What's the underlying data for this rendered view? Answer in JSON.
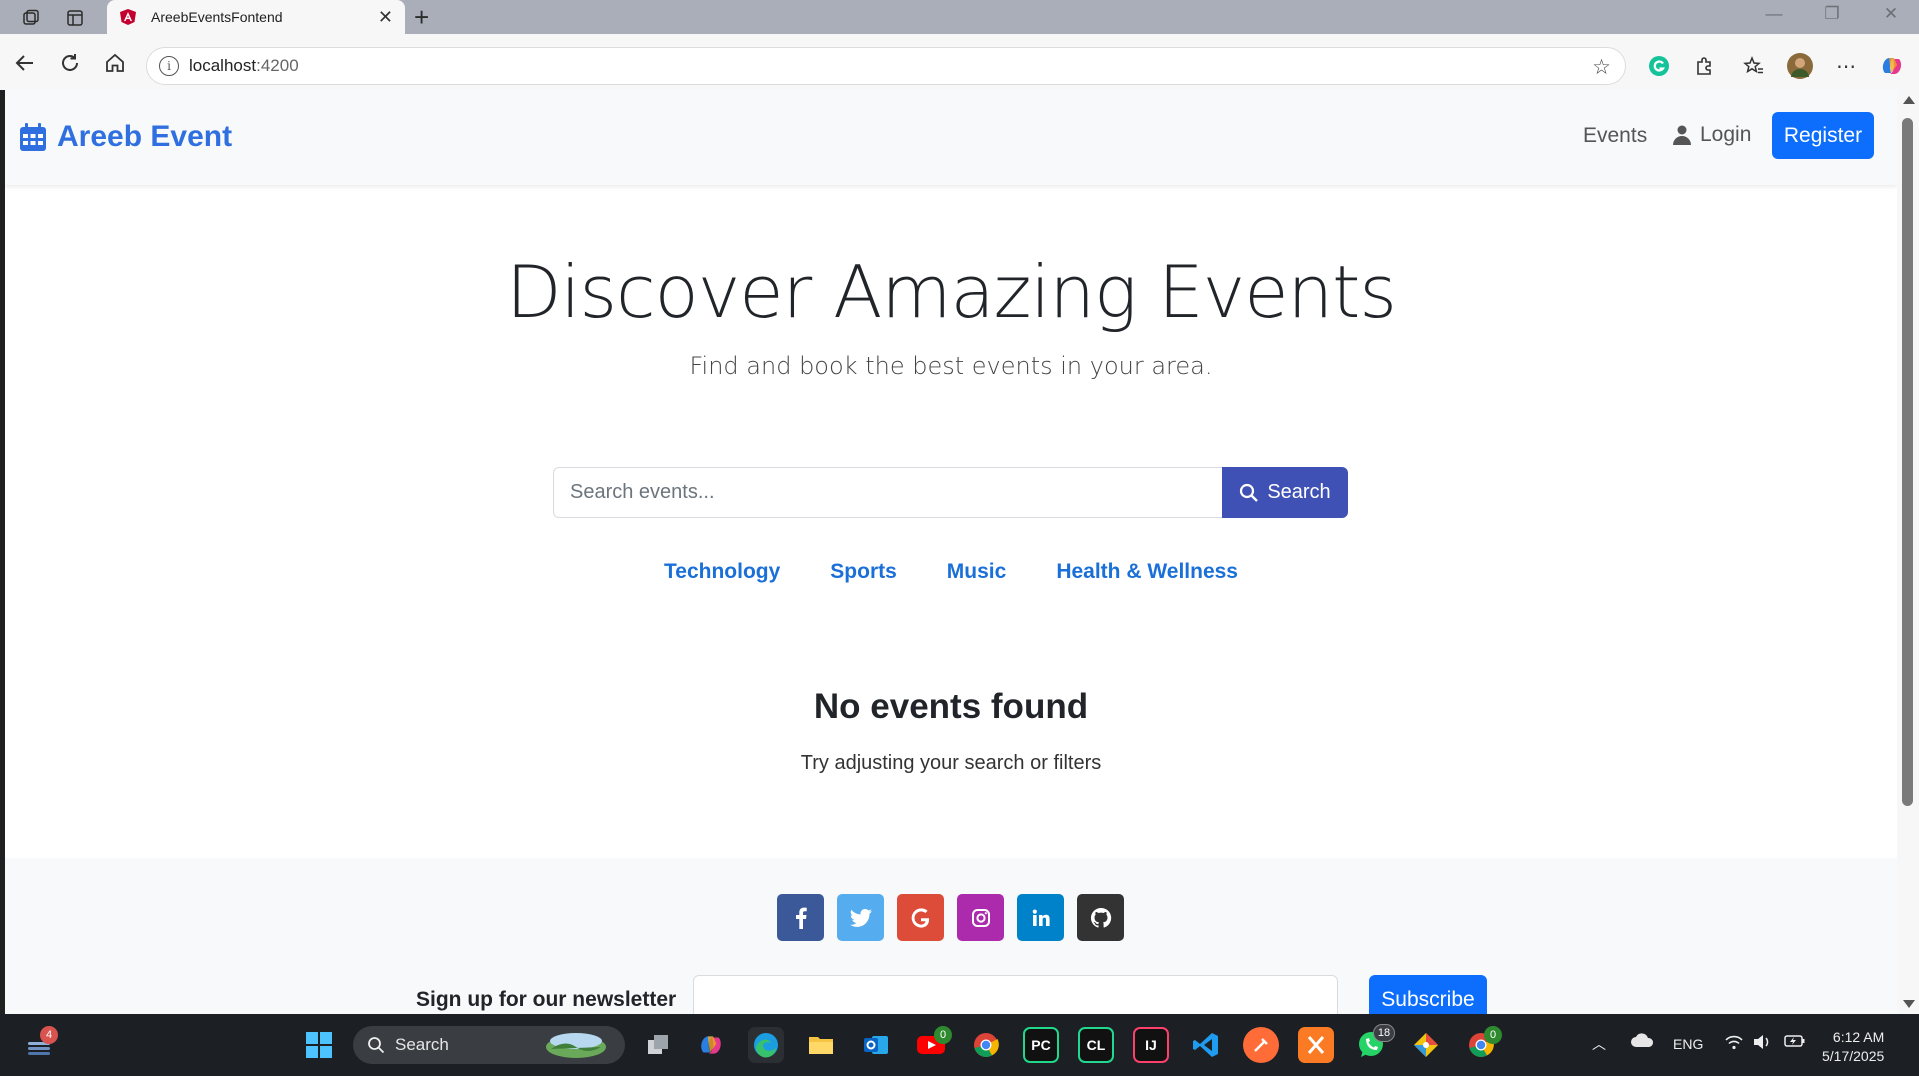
{
  "browser": {
    "tab_title": "AreebEventsFontend",
    "url_host": "localhost",
    "url_port": ":4200"
  },
  "navbar": {
    "brand": "Areeb Event",
    "events_link": "Events",
    "login_link": "Login",
    "register_button": "Register"
  },
  "hero": {
    "title": "Discover Amazing Events",
    "subtitle": "Find and book the best events in your area."
  },
  "search": {
    "placeholder": "Search events...",
    "button_label": "Search"
  },
  "categories": [
    "Technology",
    "Sports",
    "Music",
    "Health & Wellness"
  ],
  "empty_state": {
    "title": "No events found",
    "message": "Try adjusting your search or filters"
  },
  "footer": {
    "socials": [
      {
        "name": "facebook-icon",
        "color": "#3b5998",
        "glyph": "f"
      },
      {
        "name": "twitter-icon",
        "color": "#55acee",
        "glyph": "t"
      },
      {
        "name": "google-icon",
        "color": "#dd4b39",
        "glyph": "G"
      },
      {
        "name": "instagram-icon",
        "color": "#ac2bac",
        "glyph": "◎"
      },
      {
        "name": "linkedin-icon",
        "color": "#0082ca",
        "glyph": "in"
      },
      {
        "name": "github-icon",
        "color": "#333333",
        "glyph": "⌾"
      }
    ],
    "newsletter_label": "Sign up for our newsletter",
    "subscribe_button": "Subscribe"
  },
  "taskbar": {
    "search_label": "Search",
    "notification_count": "4",
    "youtube_badge": "0",
    "whatsapp_badge": "18",
    "chrome_badge": "0",
    "language": "ENG",
    "time": "6:12 AM",
    "date": "5/17/2025"
  },
  "colors": {
    "brand": "#2f6fe0",
    "primary": "#0d6efd",
    "search_button": "#3f51b5",
    "category_link": "#1a6fd8"
  }
}
